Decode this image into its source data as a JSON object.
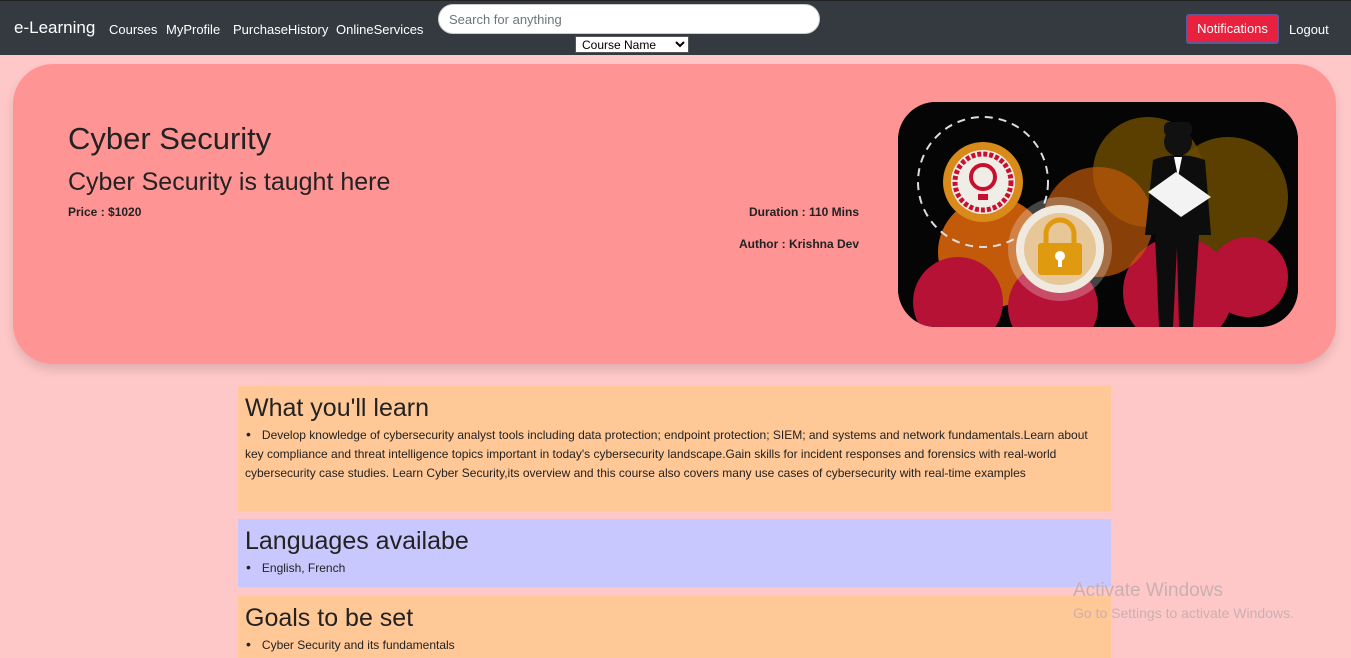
{
  "navbar": {
    "brand": "e-Learning",
    "links": [
      "Courses",
      "MyProfile",
      "PurchaseHistory",
      "OnlineServices"
    ],
    "search_placeholder": "Search for anything",
    "filter_selected": "Course Name",
    "notifications_label": "Notifications",
    "logout_label": "Logout"
  },
  "course": {
    "title": "Cyber Security",
    "subtitle": "Cyber Security is taught here",
    "price": "Price : $1020",
    "duration": "Duration : 110 Mins",
    "author": "Author : Krishna Dev"
  },
  "sections": {
    "learn": {
      "title": "What you'll learn",
      "items": [
        "Develop knowledge of cybersecurity analyst tools including data protection; endpoint protection; SIEM; and systems and network fundamentals.Learn about key compliance and threat intelligence topics important in today's cybersecurity landscape.Gain skills for incident responses and forensics with real-world cybersecurity case studies. Learn Cyber Security,its overview and this course also covers many use cases of cybersecurity with real-time examples"
      ]
    },
    "languages": {
      "title": "Languages availabe",
      "items": [
        "English, French"
      ]
    },
    "goals": {
      "title": "Goals to be set",
      "items": [
        "Cyber Security and its fundamentals"
      ]
    }
  },
  "watermark": {
    "line1": "Activate Windows",
    "line2": "Go to Settings to activate Windows."
  },
  "colors": {
    "navbar": "#343a40",
    "page_bg": "#ffc8c8",
    "hero_bg": "#ff9494",
    "section_orange": "#ffc896",
    "section_blue": "#c8c8ff",
    "notification_button": "#e8213f"
  }
}
